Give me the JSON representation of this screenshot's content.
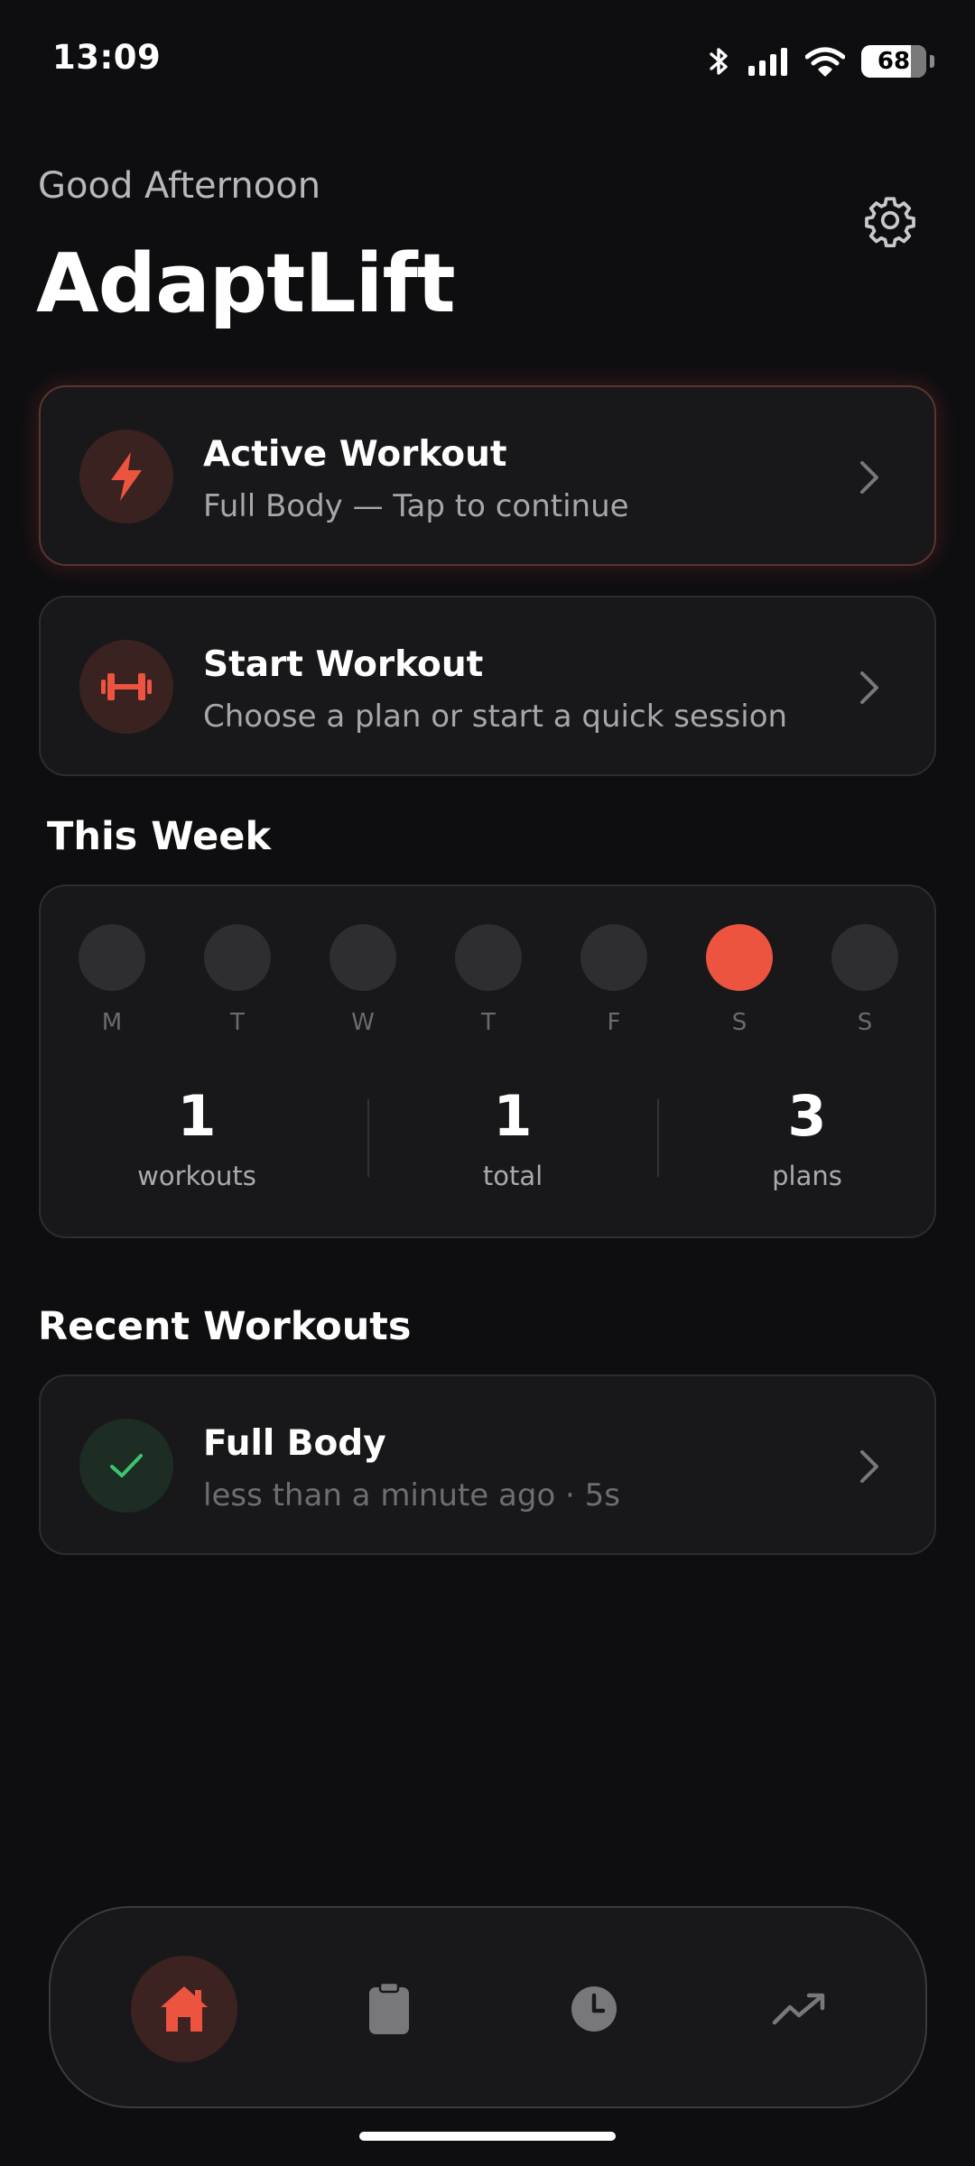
{
  "status_bar": {
    "time": "13:09",
    "battery_level": "68",
    "icons": [
      "bluetooth-icon",
      "signal-icon",
      "wifi-icon",
      "battery-icon"
    ]
  },
  "header": {
    "greeting": "Good Afternoon",
    "title": "AdaptLift",
    "settings_icon": "gear-icon"
  },
  "cards": {
    "active_workout": {
      "title": "Active Workout",
      "subtitle": "Full Body — Tap to continue",
      "icon": "lightning-bolt-icon"
    },
    "start_workout": {
      "title": "Start Workout",
      "subtitle": "Choose a plan or start a quick session",
      "icon": "dumbbell-icon"
    }
  },
  "this_week": {
    "title": "This Week",
    "days": [
      {
        "label": "M",
        "done": false
      },
      {
        "label": "T",
        "done": false
      },
      {
        "label": "W",
        "done": false
      },
      {
        "label": "T",
        "done": false
      },
      {
        "label": "F",
        "done": false
      },
      {
        "label": "S",
        "done": true
      },
      {
        "label": "S",
        "done": false
      }
    ],
    "stats": [
      {
        "value": "1",
        "label": "workouts"
      },
      {
        "value": "1",
        "label": "total"
      },
      {
        "value": "3",
        "label": "plans"
      }
    ]
  },
  "recent": {
    "title": "Recent Workouts",
    "items": [
      {
        "title": "Full Body",
        "subtitle": "less than a minute ago · 5s",
        "icon": "checkmark-icon"
      }
    ]
  },
  "bottom_nav": {
    "items": [
      {
        "icon": "home-icon",
        "active": true
      },
      {
        "icon": "clipboard-icon",
        "active": false
      },
      {
        "icon": "clock-icon",
        "active": false
      },
      {
        "icon": "trending-up-icon",
        "active": false
      }
    ]
  },
  "colors": {
    "background": "#0e0e11",
    "card": "#18181b",
    "accent": "#ec5440",
    "success": "#3ec46d"
  }
}
